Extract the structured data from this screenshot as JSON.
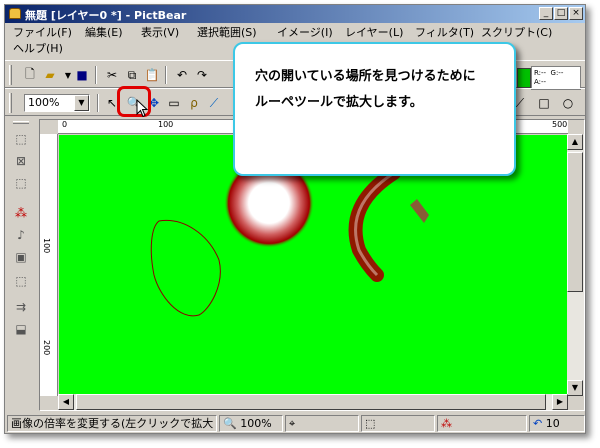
{
  "window": {
    "title": "無題 [レイヤー0 *] - PictBear"
  },
  "menu": {
    "file": "ファイル(F)",
    "edit": "編集(E)",
    "view": "表示(V)",
    "select": "選択範囲(S)",
    "image": "イメージ(I)",
    "layer": "レイヤー(L)",
    "filter": "フィルタ(T)",
    "script": "スクリプト(C)",
    "help": "ヘルプ(H)"
  },
  "toolbar": {
    "zoom": "100%"
  },
  "ruler": {
    "top_ticks": [
      "0",
      "100",
      "500"
    ],
    "left_ticks": [
      "100",
      "200"
    ]
  },
  "color_panel": {
    "r": "R:--",
    "g": "G:--",
    "a": "A:--"
  },
  "status": {
    "hint": "画像の倍率を変更する(左クリックで拡大",
    "zoom": "100%",
    "history": "10"
  },
  "callout": {
    "line1": "穴の開いている場所を見つけるために",
    "line2": "ルーペツールで拡大します。"
  },
  "colors": {
    "canvas": "#00ff00",
    "highlight": "#e00000",
    "callout_border": "#3cc8e6"
  }
}
